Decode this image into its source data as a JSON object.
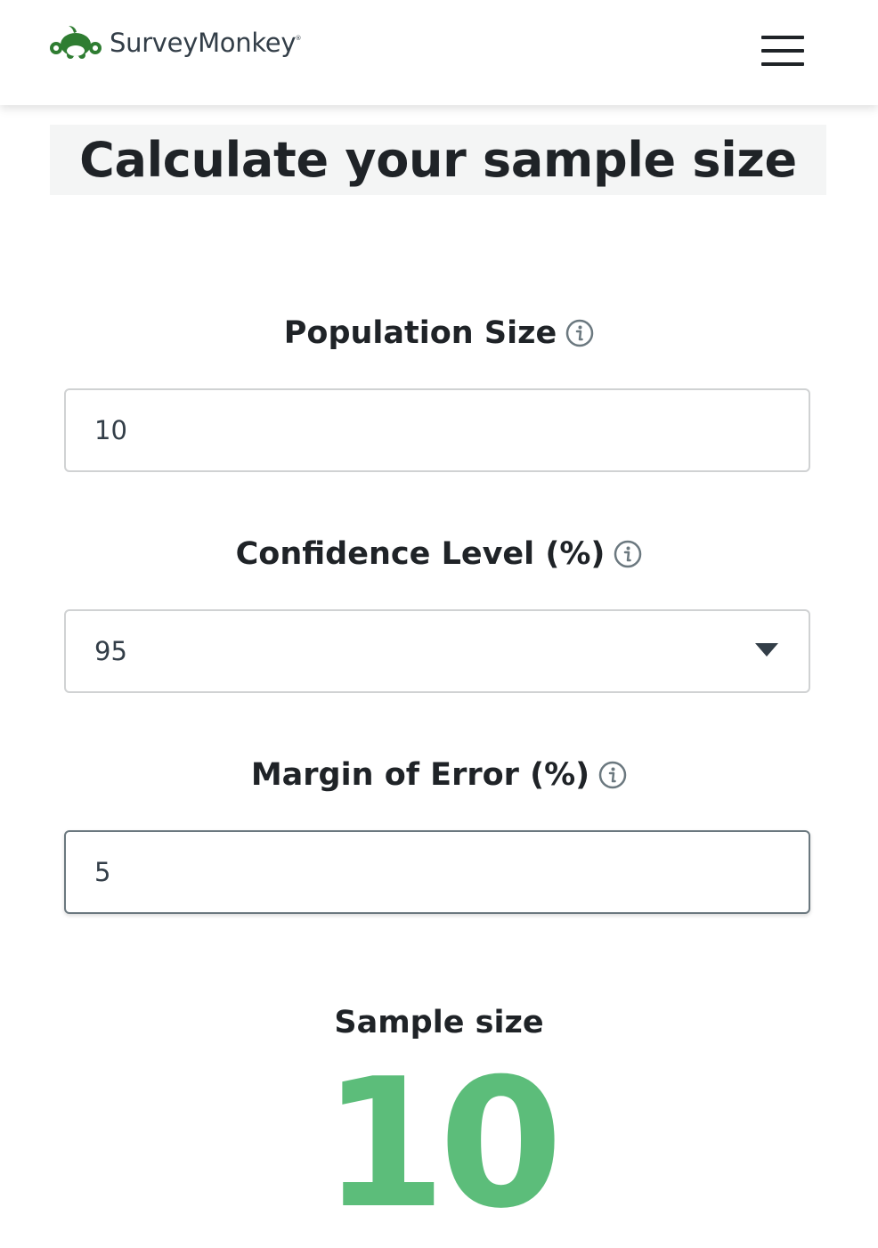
{
  "header": {
    "brand": "SurveyMonkey",
    "brand_mark": "®",
    "brand_color": "#2f7d32",
    "menu_icon": "hamburger-menu-icon"
  },
  "page": {
    "title": "Calculate your sample size"
  },
  "fields": {
    "population": {
      "label": "Population Size",
      "value": "10",
      "icon": "info-icon"
    },
    "confidence": {
      "label": "Confidence Level (%)",
      "value": "95",
      "icon": "info-icon"
    },
    "margin": {
      "label": "Margin of Error (%)",
      "value": "5",
      "icon": "info-icon"
    }
  },
  "result": {
    "label": "Sample size",
    "value": "10",
    "color": "#5cbd7a"
  }
}
